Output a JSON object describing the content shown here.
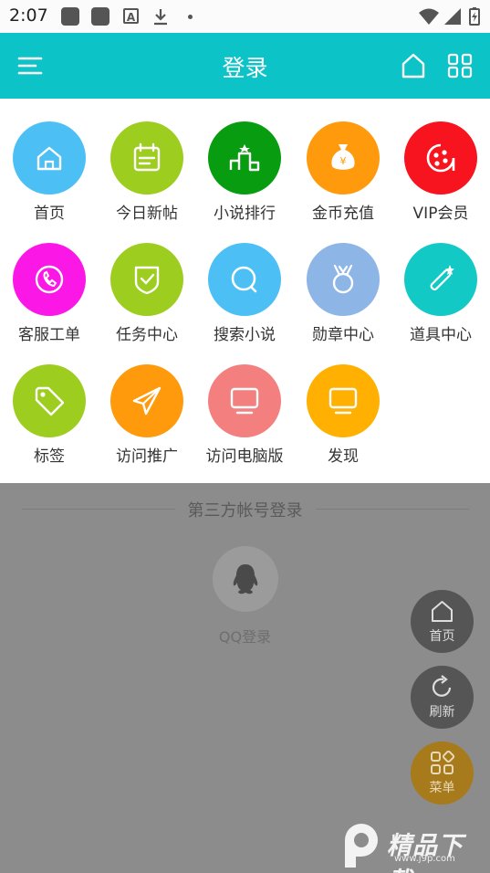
{
  "status_bar": {
    "time": "2:07",
    "icons": [
      "app-icon",
      "app-icon",
      "font-icon",
      "download-icon",
      "dot-icon",
      "wifi-icon",
      "signal-icon",
      "battery-icon"
    ]
  },
  "header": {
    "title": "登录",
    "color": "#0cc4c8",
    "icons": [
      "menu-icon",
      "home-icon",
      "grid-icon"
    ]
  },
  "grid": {
    "items": [
      {
        "label": "首页",
        "color": "#4cc0f5",
        "icon": "home-icon"
      },
      {
        "label": "今日新帖",
        "color": "#9dcd1e",
        "icon": "calendar-icon"
      },
      {
        "label": "小说排行",
        "color": "#089c10",
        "icon": "podium-icon"
      },
      {
        "label": "金币充值",
        "color": "#ff9a0c",
        "icon": "money-bag-icon"
      },
      {
        "label": "VIP会员",
        "color": "#f7141e",
        "icon": "film-reel-icon"
      },
      {
        "label": "客服工单",
        "color": "#fb18e7",
        "icon": "phone-icon"
      },
      {
        "label": "任务中心",
        "color": "#9dcd1e",
        "icon": "check-shield-icon"
      },
      {
        "label": "搜索小说",
        "color": "#4cc0f5",
        "icon": "search-icon"
      },
      {
        "label": "勋章中心",
        "color": "#8db5e6",
        "icon": "medal-icon"
      },
      {
        "label": "道具中心",
        "color": "#12c9c6",
        "icon": "magic-wand-icon"
      },
      {
        "label": "标签",
        "color": "#9dcd1e",
        "icon": "tag-icon"
      },
      {
        "label": "访问推广",
        "color": "#ff9a0c",
        "icon": "paper-plane-icon"
      },
      {
        "label": "访问电脑版",
        "color": "#f47f7f",
        "icon": "monitor-icon"
      },
      {
        "label": "发现",
        "color": "#ffb000",
        "icon": "monitor-icon"
      }
    ]
  },
  "third_party": {
    "heading": "第三方帐号登录",
    "qq_label": "QQ登录"
  },
  "fabs": [
    {
      "label": "首页",
      "icon": "home-icon"
    },
    {
      "label": "刷新",
      "icon": "refresh-icon"
    },
    {
      "label": "菜单",
      "icon": "grid-icon"
    }
  ],
  "watermark": {
    "text": "精品下载",
    "url": "www.j9p.com"
  }
}
